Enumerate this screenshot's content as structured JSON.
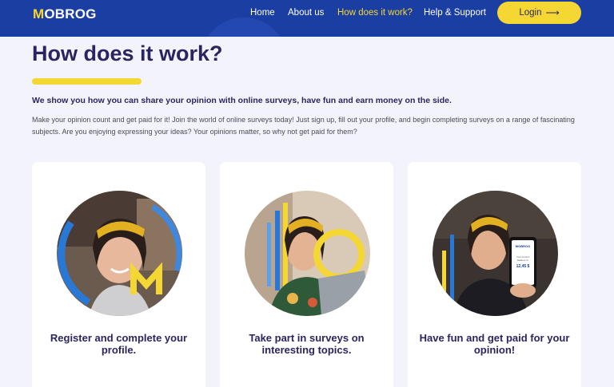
{
  "header": {
    "logo_prefix": "M",
    "logo_rest": "OBROG",
    "nav": {
      "home": "Home",
      "about": "About us",
      "how": "How does it work?",
      "help": "Help & Support"
    },
    "login_label": "Login",
    "login_arrow": "⟶"
  },
  "colors": {
    "brand_blue": "#1a3ea1",
    "accent_yellow": "#f5d733",
    "heading": "#2a2560"
  },
  "main": {
    "title": "How does it work?",
    "lead": "We show you how you can share your opinion with online surveys, have fun and earn money on the side.",
    "body": "Make your opinion count and get paid for it! Join the world of online surveys today! Just sign up, fill out your profile, and begin completing surveys on a range of fascinating subjects. Are you enjoying expressing your ideas? Your opinions matter, so why not get paid for them?"
  },
  "cards": [
    {
      "caption": "Register and complete your profile."
    },
    {
      "caption": "Take part in surveys on interesting topics."
    },
    {
      "caption": "Have fun and get paid for your opinion!"
    }
  ],
  "phone": {
    "brand": "MOBROG",
    "balance_label": "Your current balance is:",
    "balance": "12,45 $"
  }
}
